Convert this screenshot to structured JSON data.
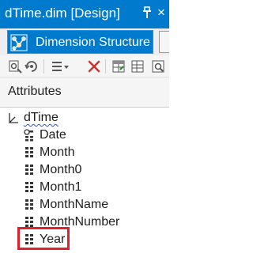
{
  "window": {
    "title": "dTime.dim [Design]",
    "pin_icon": "pin-icon",
    "close_label": "×"
  },
  "tabs": {
    "active_label": "Dimension Structure",
    "active_icon": "dimension-structure-icon"
  },
  "toolbar": {
    "icons": [
      "process-icon",
      "refresh-icon",
      "view-dropdown-icon",
      "delete-icon",
      "show-table-icon",
      "new-named-query-icon",
      "explore-data-icon"
    ]
  },
  "attributes_pane": {
    "header": "Attributes"
  },
  "tree": {
    "root": {
      "label": "dTime",
      "icon": "dimension-icon"
    },
    "items": [
      {
        "label": "Date",
        "icon": "key-attribute-icon"
      },
      {
        "label": "Month",
        "icon": "attribute-icon"
      },
      {
        "label": "Month0",
        "icon": "attribute-icon"
      },
      {
        "label": "Month1",
        "icon": "attribute-icon"
      },
      {
        "label": "MonthName",
        "icon": "attribute-icon"
      },
      {
        "label": "MonthNumber",
        "icon": "attribute-icon"
      },
      {
        "label": "Year",
        "icon": "attribute-icon",
        "highlighted": true
      }
    ]
  },
  "colors": {
    "accent": "#007acc",
    "highlight_border": "#e0202a"
  }
}
